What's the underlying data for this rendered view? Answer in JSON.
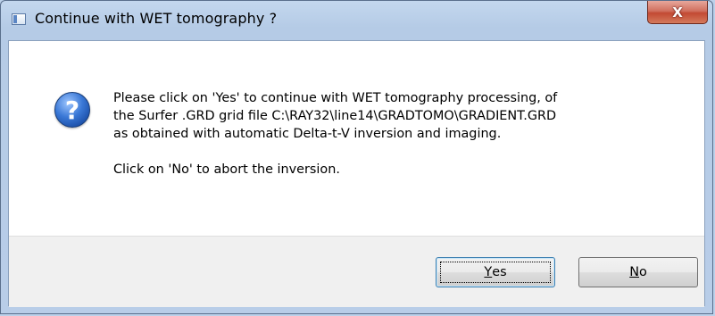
{
  "window": {
    "title": "Continue with WET tomography ?",
    "close_glyph": "X"
  },
  "message": {
    "icon": "question-icon",
    "line1": "Please click on 'Yes' to continue with WET tomography processing, of",
    "line2": "the Surfer .GRD grid file C:\\RAY32\\line14\\GRADTOMO\\GRADIENT.GRD",
    "line3": "as obtained with automatic Delta-t-V inversion and imaging.",
    "line4": "Click on 'No' to abort the inversion."
  },
  "buttons": {
    "yes": {
      "mnemonic": "Y",
      "rest": "es"
    },
    "no": {
      "mnemonic": "N",
      "rest": "o"
    }
  }
}
